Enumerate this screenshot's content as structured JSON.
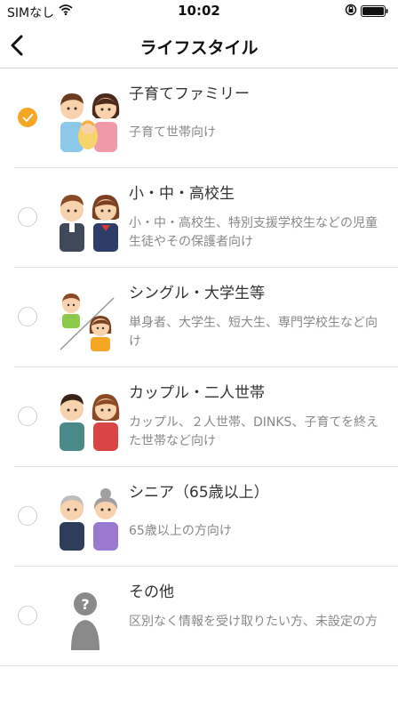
{
  "status_bar": {
    "carrier": "SIMなし",
    "time": "10:02"
  },
  "nav": {
    "title": "ライフスタイル"
  },
  "options": [
    {
      "title": "子育てファミリー",
      "description": "子育て世帯向け",
      "selected": true
    },
    {
      "title": "小・中・高校生",
      "description": "小・中・高校生、特別支援学校生などの児童生徒やその保護者向け",
      "selected": false
    },
    {
      "title": "シングル・大学生等",
      "description": "単身者、大学生、短大生、専門学校生など向け",
      "selected": false
    },
    {
      "title": "カップル・二人世帯",
      "description": "カップル、２人世帯、DINKS、子育てを終えた世帯など向け",
      "selected": false
    },
    {
      "title": "シニア（65歳以上）",
      "description": "65歳以上の方向け",
      "selected": false
    },
    {
      "title": "その他",
      "description": "区別なく情報を受け取りたい方、未設定の方",
      "selected": false
    }
  ],
  "colors": {
    "accent": "#f5a623"
  }
}
